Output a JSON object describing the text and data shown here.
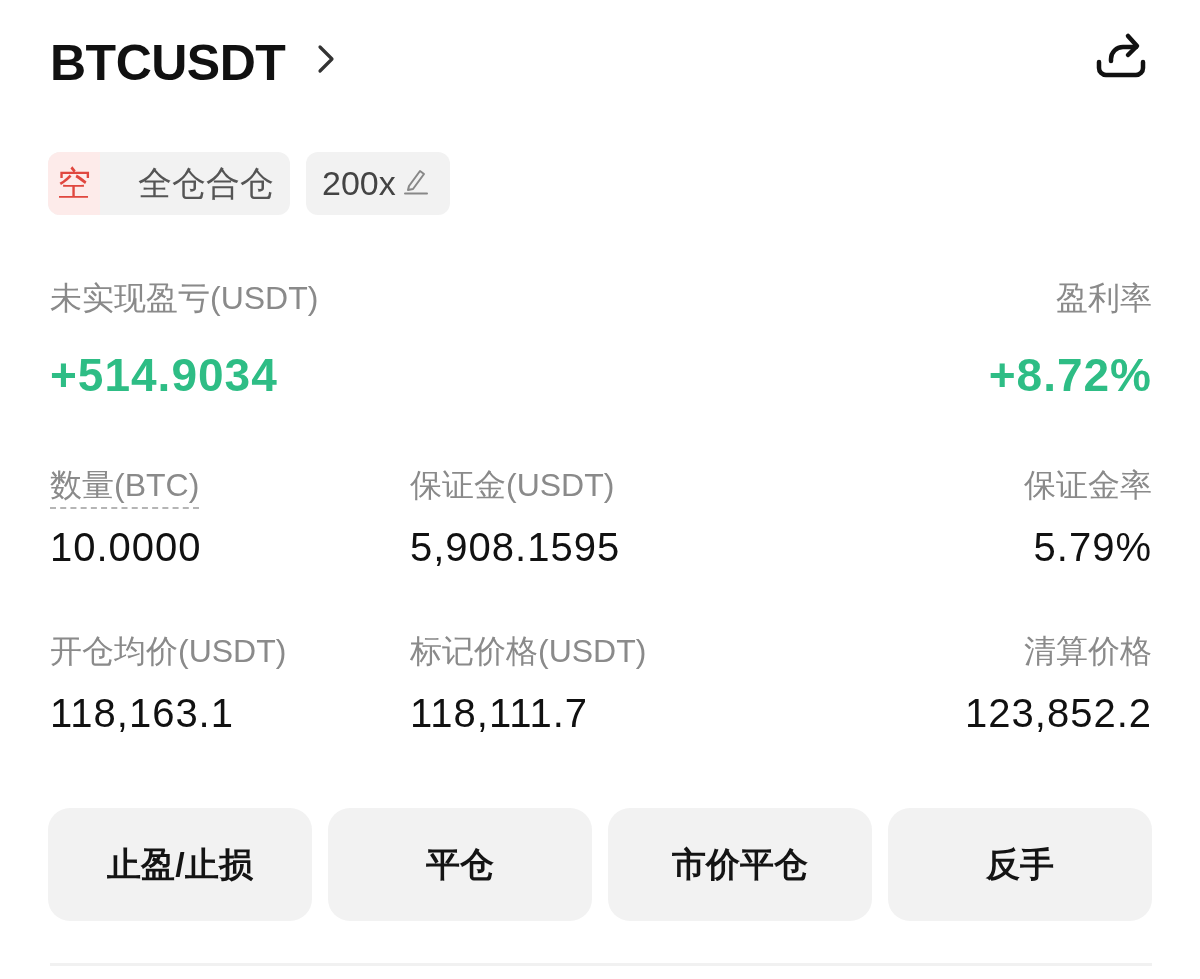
{
  "header": {
    "symbol": "BTCUSDT"
  },
  "position_tags": {
    "side": "空",
    "margin_mode": "全仓合仓",
    "leverage": "200x"
  },
  "pnl": [
    {
      "label": "未实现盈亏(USDT)",
      "value": "+514.9034"
    },
    {
      "label": "盈利率",
      "value": "+8.72%"
    }
  ],
  "stats": [
    {
      "label": "数量(BTC)",
      "value": "10.0000",
      "underlined": true
    },
    {
      "label": "保证金(USDT)",
      "value": "5,908.1595",
      "underlined": false
    },
    {
      "label": "保证金率",
      "value": "5.79%",
      "underlined": false
    },
    {
      "label": "开仓均价(USDT)",
      "value": "118,163.1",
      "underlined": false
    },
    {
      "label": "标记价格(USDT)",
      "value": "118,111.7",
      "underlined": false
    },
    {
      "label": "清算价格",
      "value": "123,852.2",
      "underlined": false
    }
  ],
  "buttons": [
    "止盈/止损",
    "平仓",
    "市价平仓",
    "反手"
  ]
}
